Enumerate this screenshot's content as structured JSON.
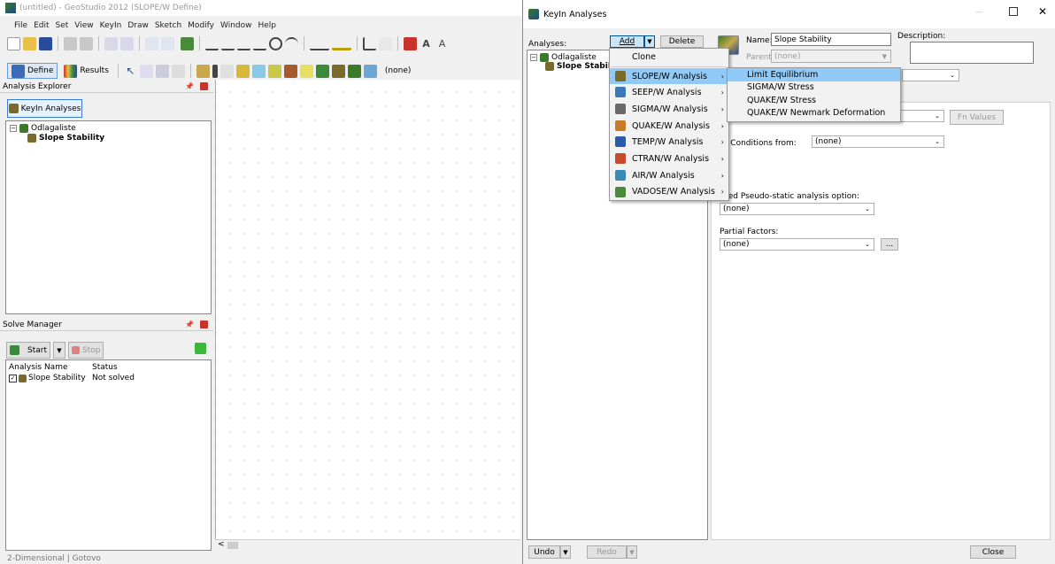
{
  "main_window": {
    "title": "(untitled) - GeoStudio 2012 (SLOPE/W Define)",
    "menu": [
      "File",
      "Edit",
      "Set",
      "View",
      "KeyIn",
      "Draw",
      "Sketch",
      "Modify",
      "Window",
      "Help"
    ],
    "define_label": "Define",
    "results_label": "Results",
    "toolbar_combo_value": "(none)",
    "status_bar": "2-Dimensional  |  Gotovo"
  },
  "analysis_explorer": {
    "title": "Analysis Explorer",
    "keyin_button": "KeyIn Analyses",
    "tree_root": "Odlagaliste",
    "tree_child": "Slope Stability"
  },
  "solve_manager": {
    "title": "Solve Manager",
    "start_label": "Start",
    "stop_label": "Stop",
    "col_name": "Analysis Name",
    "col_status": "Status",
    "rows": [
      {
        "name": "Slope Stability",
        "status": "Not solved"
      }
    ]
  },
  "dialog": {
    "title": "KeyIn Analyses",
    "analyses_label": "Analyses:",
    "add_label": "Add",
    "delete_label": "Delete",
    "tree_root": "Odlagaliste",
    "tree_child": "Slope Stabilit",
    "name_label": "Name:",
    "name_value": "Slope Stability",
    "parent_label": "Parent:",
    "parent_value": "(none)",
    "description_label": "Description:",
    "fn_values_label": "Fn Values",
    "pwp_label": "P Conditions from:",
    "pwp_value": "(none)",
    "pseudo_label": "ged Pseudo-static analysis option:",
    "pseudo_value": "(none)",
    "partial_label": "Partial Factors:",
    "partial_value": "(none)",
    "ellipsis_label": "...",
    "undo_label": "Undo",
    "redo_label": "Redo",
    "close_label": "Close"
  },
  "add_menu": {
    "clone": "Clone",
    "items": [
      {
        "label": "SLOPE/W Analysis",
        "color": "#7a6a2a"
      },
      {
        "label": "SEEP/W Analysis",
        "color": "#3a7ab8"
      },
      {
        "label": "SIGMA/W Analysis",
        "color": "#6a6a6a"
      },
      {
        "label": "QUAKE/W Analysis",
        "color": "#c87a2a"
      },
      {
        "label": "TEMP/W Analysis",
        "color": "#2a5aa8"
      },
      {
        "label": "CTRAN/W Analysis",
        "color": "#c84a2a"
      },
      {
        "label": "AIR/W Analysis",
        "color": "#3a8ab8"
      },
      {
        "label": "VADOSE/W Analysis",
        "color": "#4a8a3a"
      }
    ]
  },
  "slope_submenu": {
    "items": [
      "Limit Equilibrium",
      "SIGMA/W Stress",
      "QUAKE/W Stress",
      "QUAKE/W Newmark Deformation"
    ]
  }
}
